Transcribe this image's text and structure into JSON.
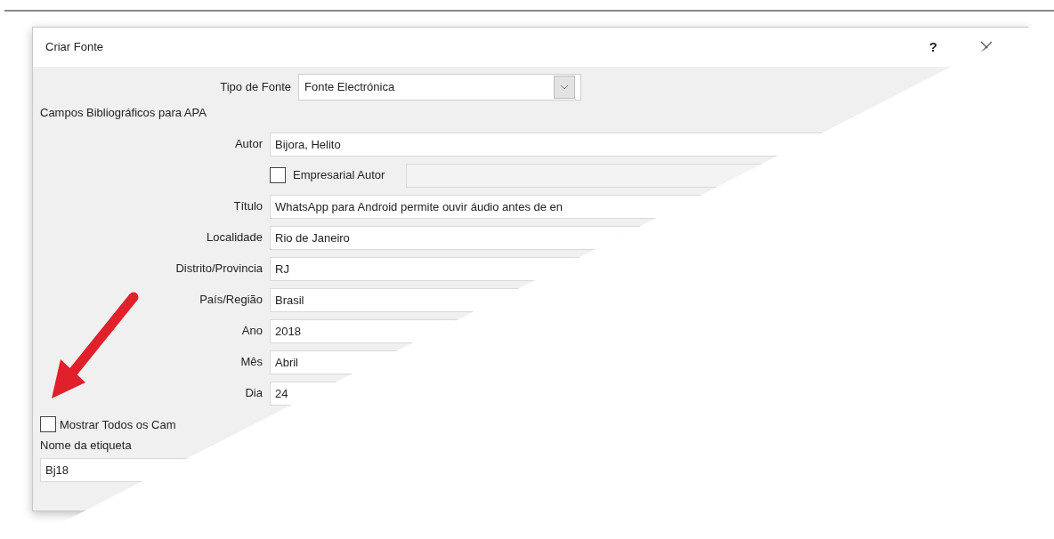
{
  "dialog": {
    "title": "Criar Fonte",
    "help": "?"
  },
  "source_type": {
    "label": "Tipo de Fonte",
    "value": "Fonte Electrónica"
  },
  "group_label": "Campos Bibliográficos para APA",
  "fields": [
    {
      "kind": "text",
      "label": "Autor",
      "value": "Bijora, Helito"
    },
    {
      "kind": "checkbox",
      "label": "Empresarial Autor",
      "checked": false
    },
    {
      "kind": "text",
      "label": "Título",
      "value": "WhatsApp para Android permite ouvir áudio antes de en"
    },
    {
      "kind": "text",
      "label": "Localidade",
      "value": "Rio de Janeiro"
    },
    {
      "kind": "text",
      "label": "Distrito/Provincia",
      "value": "RJ"
    },
    {
      "kind": "text",
      "label": "País/Região",
      "value": "Brasil"
    },
    {
      "kind": "text",
      "label": "Ano",
      "value": "2018"
    },
    {
      "kind": "text",
      "label": "Mês",
      "value": "Abril"
    },
    {
      "kind": "text",
      "label": "Dia",
      "value": "24"
    }
  ],
  "show_all": {
    "label": "Mostrar Todos os Cam",
    "checked": false
  },
  "tag_name": {
    "label": "Nome da etiqueta",
    "value": "Bj18"
  }
}
